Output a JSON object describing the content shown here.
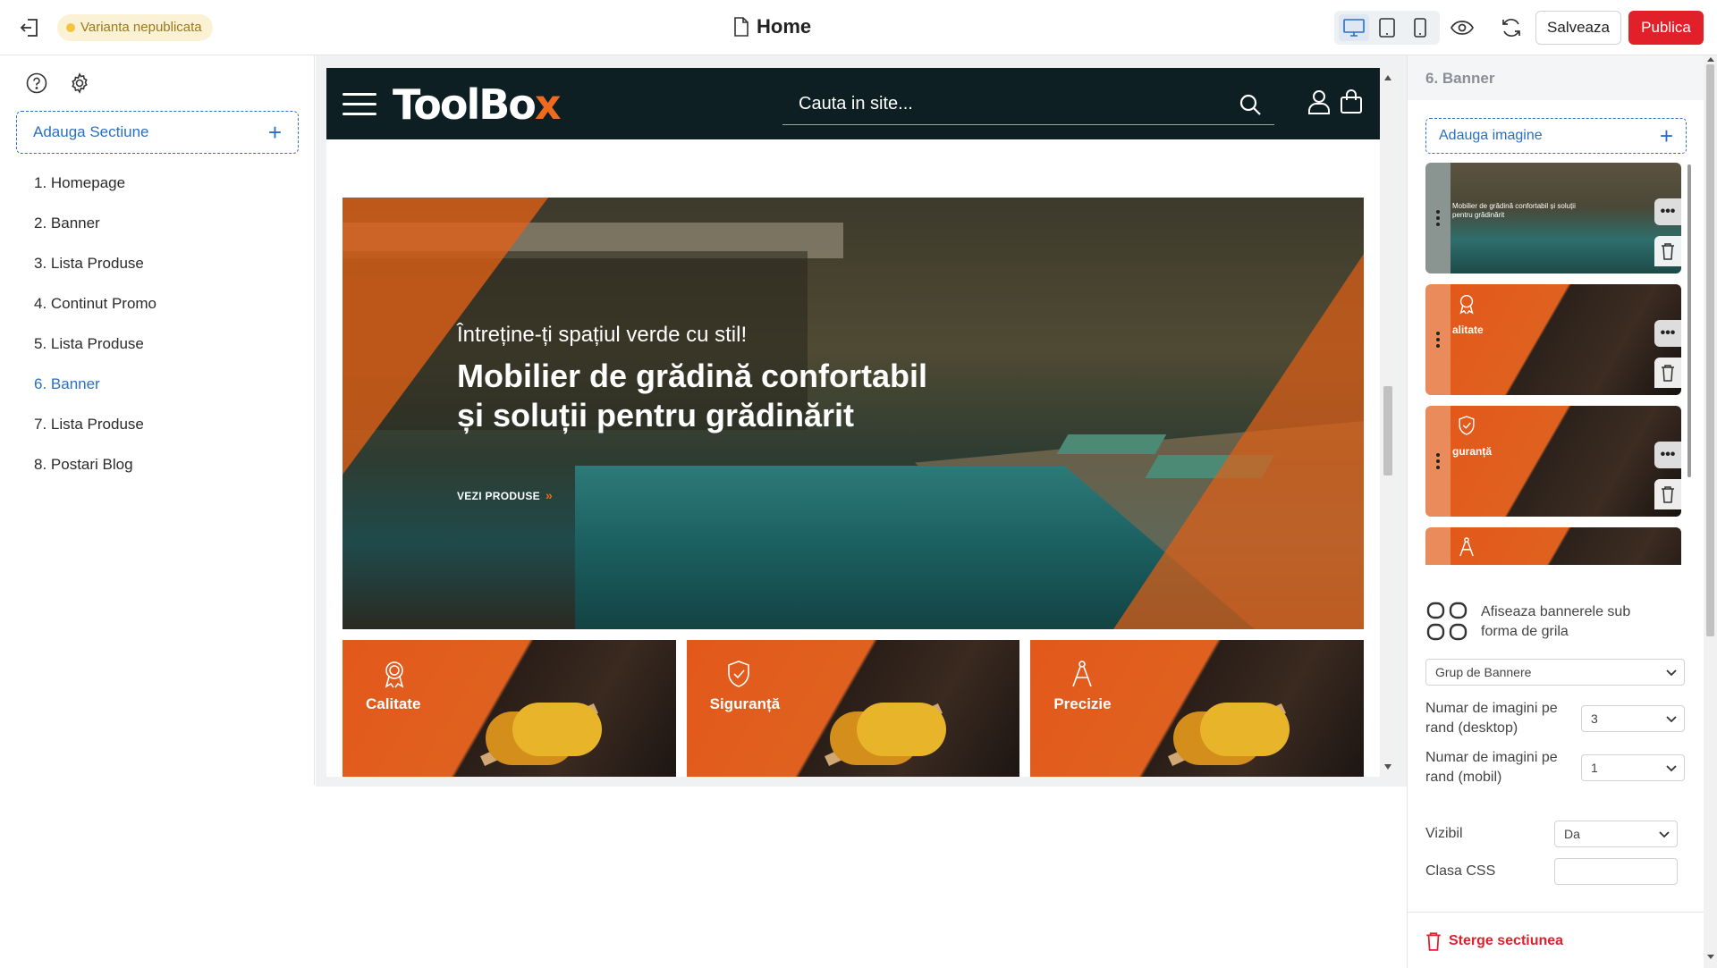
{
  "topbar": {
    "status": "Varianta nepublicata",
    "page_title": "Home",
    "save_label": "Salveaza",
    "publish_label": "Publica",
    "colors": {
      "accent": "#2a6fc4",
      "publish": "#e2202a",
      "status_bg": "#fbf1d5"
    }
  },
  "sidebar": {
    "add_section_label": "Adauga Sectiune",
    "items": [
      {
        "label": "1. Homepage"
      },
      {
        "label": "2. Banner"
      },
      {
        "label": "3. Lista Produse"
      },
      {
        "label": "4. Continut Promo"
      },
      {
        "label": "5. Lista Produse"
      },
      {
        "label": "6. Banner",
        "active": true
      },
      {
        "label": "7. Lista Produse"
      },
      {
        "label": "8. Postari Blog"
      }
    ]
  },
  "preview": {
    "logo_main": "ToolBo",
    "logo_accent": "x",
    "search_placeholder": "Cauta in site...",
    "hero": {
      "subtitle": "Întreține-ți spațiul verde cu stil!",
      "title": "Mobilier de grădină confortabil și soluții pentru grădinărit",
      "cta": "VEZI PRODUSE"
    },
    "tiles": [
      {
        "label": "Calitate",
        "icon": "award-ribbon-icon"
      },
      {
        "label": "Siguranță",
        "icon": "shield-check-icon"
      },
      {
        "label": "Precizie",
        "icon": "compass-icon"
      }
    ]
  },
  "panel": {
    "heading": "6. Banner",
    "add_image_label": "Adauga imagine",
    "thumbs": [
      {
        "caption": "Mobilier de grădină confortabil și soluții pentru grădinărit"
      },
      {
        "caption": "alitate"
      },
      {
        "caption": "guranță"
      },
      {
        "caption": ""
      }
    ],
    "grid_toggle_label": "Afiseaza bannerele sub forma de grila",
    "group_select": "Grup de Bannere",
    "per_row_desktop_label": "Numar de imagini pe rand (desktop)",
    "per_row_desktop_value": "3",
    "per_row_mobile_label": "Numar de imagini pe rand (mobil)",
    "per_row_mobile_value": "1",
    "visible_label": "Vizibil",
    "visible_value": "Da",
    "css_class_label": "Clasa CSS",
    "css_class_value": "",
    "delete_section_label": "Sterge sectiunea"
  }
}
